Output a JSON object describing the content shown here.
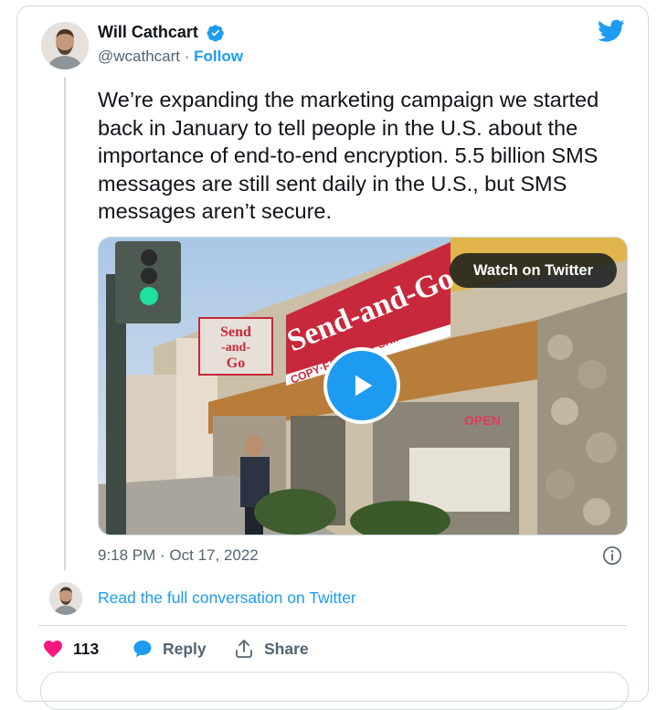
{
  "author": {
    "name": "Will Cathcart",
    "handle": "@wcathcart",
    "separator": "·",
    "follow_label": "Follow",
    "verified": true
  },
  "tweet": {
    "text": "We’re expanding the marketing campaign we started back in January to tell people in the U.S. about the importance of end-to-end encryption. 5.5 billion SMS messages are still sent daily in the U.S., but SMS messages aren’t secure.",
    "timestamp": "9:18 PM · Oct 17, 2022"
  },
  "media": {
    "watch_label": "Watch on Twitter",
    "sign_main": "Send-and-Go",
    "sign_sub": "COPY·FAX·PACK·SHIP",
    "sign_small": [
      "Send",
      "-and-",
      "Go"
    ],
    "open_sign": "OPEN"
  },
  "conversation_link": "Read the full conversation on Twitter",
  "actions": {
    "like_count": "113",
    "reply_label": "Reply",
    "share_label": "Share"
  },
  "colors": {
    "twitter_blue": "#1d9bf0",
    "like_red": "#f91880",
    "text_primary": "#0f1419",
    "text_secondary": "#536471",
    "border": "#cfd9de"
  },
  "icons": [
    "verified-badge-icon",
    "twitter-bird-icon",
    "play-icon",
    "info-icon",
    "heart-icon",
    "reply-bubble-icon",
    "share-icon"
  ]
}
